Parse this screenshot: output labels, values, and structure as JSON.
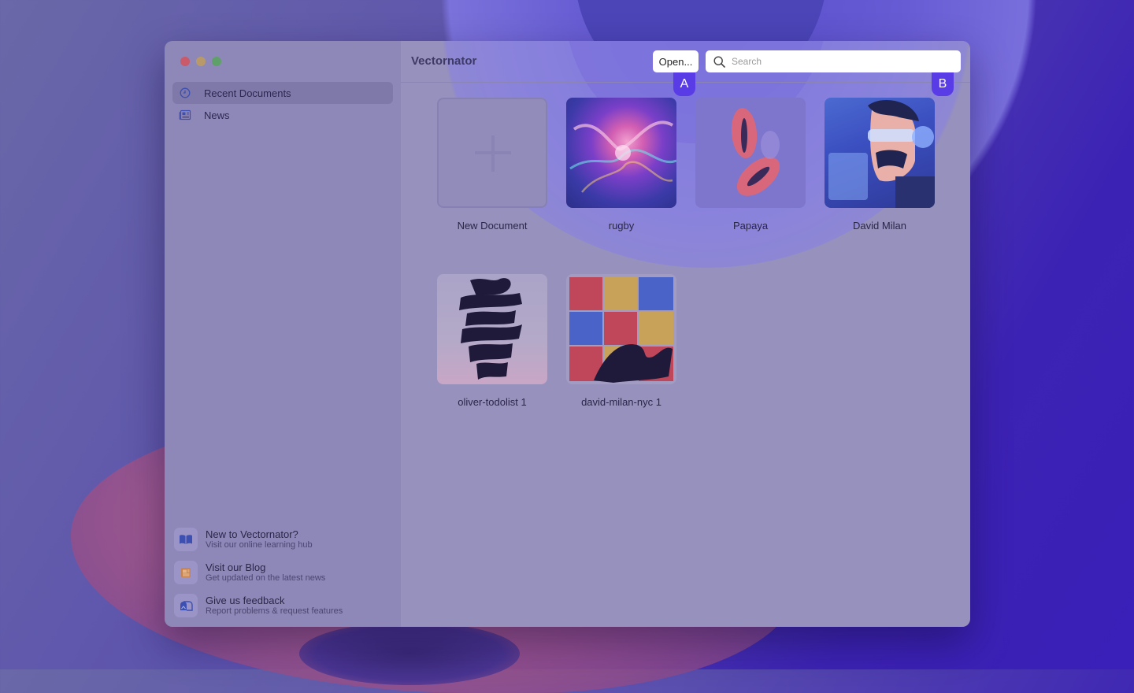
{
  "app": {
    "title": "Vectornator"
  },
  "toolbar": {
    "open_label": "Open...",
    "search_placeholder": "Search"
  },
  "badges": {
    "a": "A",
    "b": "B"
  },
  "sidebar": {
    "items": [
      {
        "label": "Recent Documents",
        "icon": "clock-icon",
        "active": true
      },
      {
        "label": "News",
        "icon": "newspaper-icon",
        "active": false
      }
    ],
    "help": [
      {
        "title": "New to Vectornator?",
        "subtitle": "Visit our online learning hub",
        "icon": "book-icon"
      },
      {
        "title": "Visit our Blog",
        "subtitle": "Get updated on the latest news",
        "icon": "blog-icon"
      },
      {
        "title": "Give us feedback",
        "subtitle": "Report problems & request features",
        "icon": "mailbox-icon"
      }
    ]
  },
  "documents": [
    {
      "label": "New Document"
    },
    {
      "label": "rugby"
    },
    {
      "label": "Papaya"
    },
    {
      "label": "David Milan"
    },
    {
      "label": "oliver-todolist 1"
    },
    {
      "label": "david-milan-nyc 1"
    }
  ],
  "colors": {
    "accent": "#5a3ce6",
    "sidebar": "#8e88b8",
    "main": "#9791bd"
  }
}
